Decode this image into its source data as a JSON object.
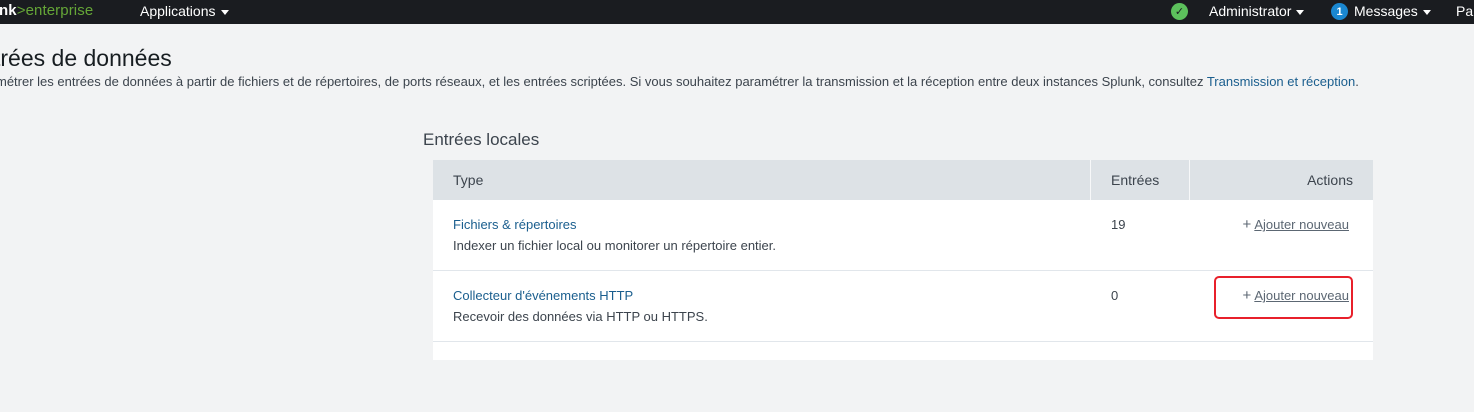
{
  "topbar": {
    "logo_prefix": "nk",
    "logo_suffix": ">enterprise",
    "apps_label": "Applications",
    "admin_label": "Administrator",
    "messages_count": "1",
    "messages_label": "Messages",
    "truncated_label": "Pa"
  },
  "page": {
    "title": "trées de données",
    "description_prefix": "métrer les entrées de données à partir de fichiers et de répertoires, de ports réseaux, et les entrées scriptées. Si vous souhaitez paramétrer la transmission et la réception entre deux instances Splunk, consultez ",
    "description_link": "Transmission et réception",
    "description_suffix": "."
  },
  "local_inputs": {
    "title": "Entrées locales",
    "columns": [
      "Type",
      "Entrées",
      "Actions"
    ],
    "rows": [
      {
        "name": "Fichiers & répertoires",
        "description": "Indexer un fichier local ou monitorer un répertoire entier.",
        "count": "19",
        "action": "Ajouter nouveau"
      },
      {
        "name": "Collecteur d'événements HTTP",
        "description": "Recevoir des données via HTTP ou HTTPS.",
        "count": "0",
        "action": "Ajouter nouveau"
      }
    ]
  },
  "colors": {
    "topbar": "#1a1c20",
    "brand_green": "#65a637",
    "link": "#1a5e8e",
    "highlight": "#e8202b"
  },
  "icons": {
    "status": "check-circle-icon",
    "caret": "caret-down-icon",
    "plus": "plus-icon"
  }
}
